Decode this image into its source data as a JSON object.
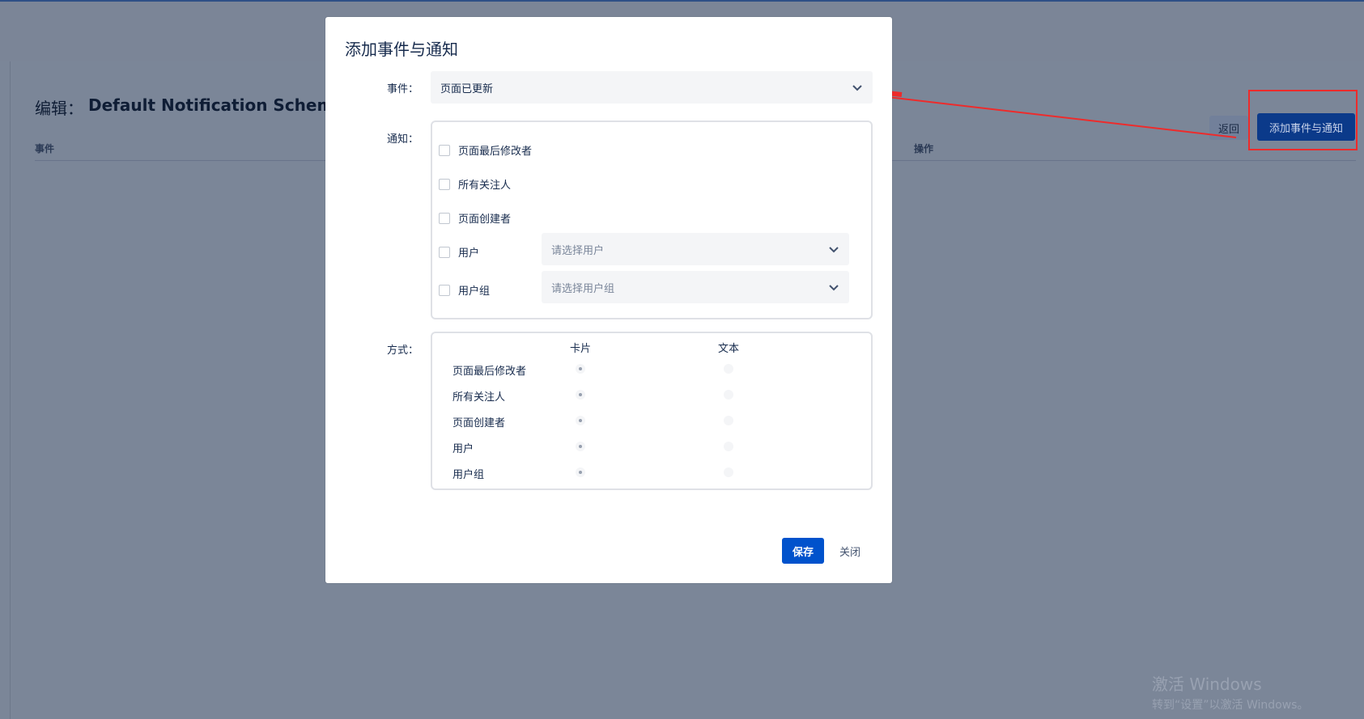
{
  "background": {
    "title_prefix": "编辑：",
    "title_scheme": "Default Notification Scheme",
    "col_event": "事件",
    "col_action": "操作",
    "back_label": "返回",
    "add_label": "添加事件与通知"
  },
  "modal": {
    "title": "添加事件与通知",
    "event_label": "事件：",
    "event_value": "页面已更新",
    "notify_label": "通知：",
    "notify_options": [
      "页面最后修改者",
      "所有关注人",
      "页面创建者",
      "用户",
      "用户组"
    ],
    "user_placeholder": "请选择用户",
    "group_placeholder": "请选择用户组",
    "method_label": "方式：",
    "method_headers": [
      "卡片",
      "文本"
    ],
    "method_rows": [
      "页面最后修改者",
      "所有关注人",
      "页面创建者",
      "用户",
      "用户组"
    ],
    "save_label": "保存",
    "close_label": "关闭"
  },
  "watermark": {
    "line1": "激活 Windows",
    "line2": "转到“设置”以激活 Windows。"
  },
  "colors": {
    "primary": "#0052cc",
    "annotation": "#ee2b2b",
    "overlay": "#7b8698"
  }
}
